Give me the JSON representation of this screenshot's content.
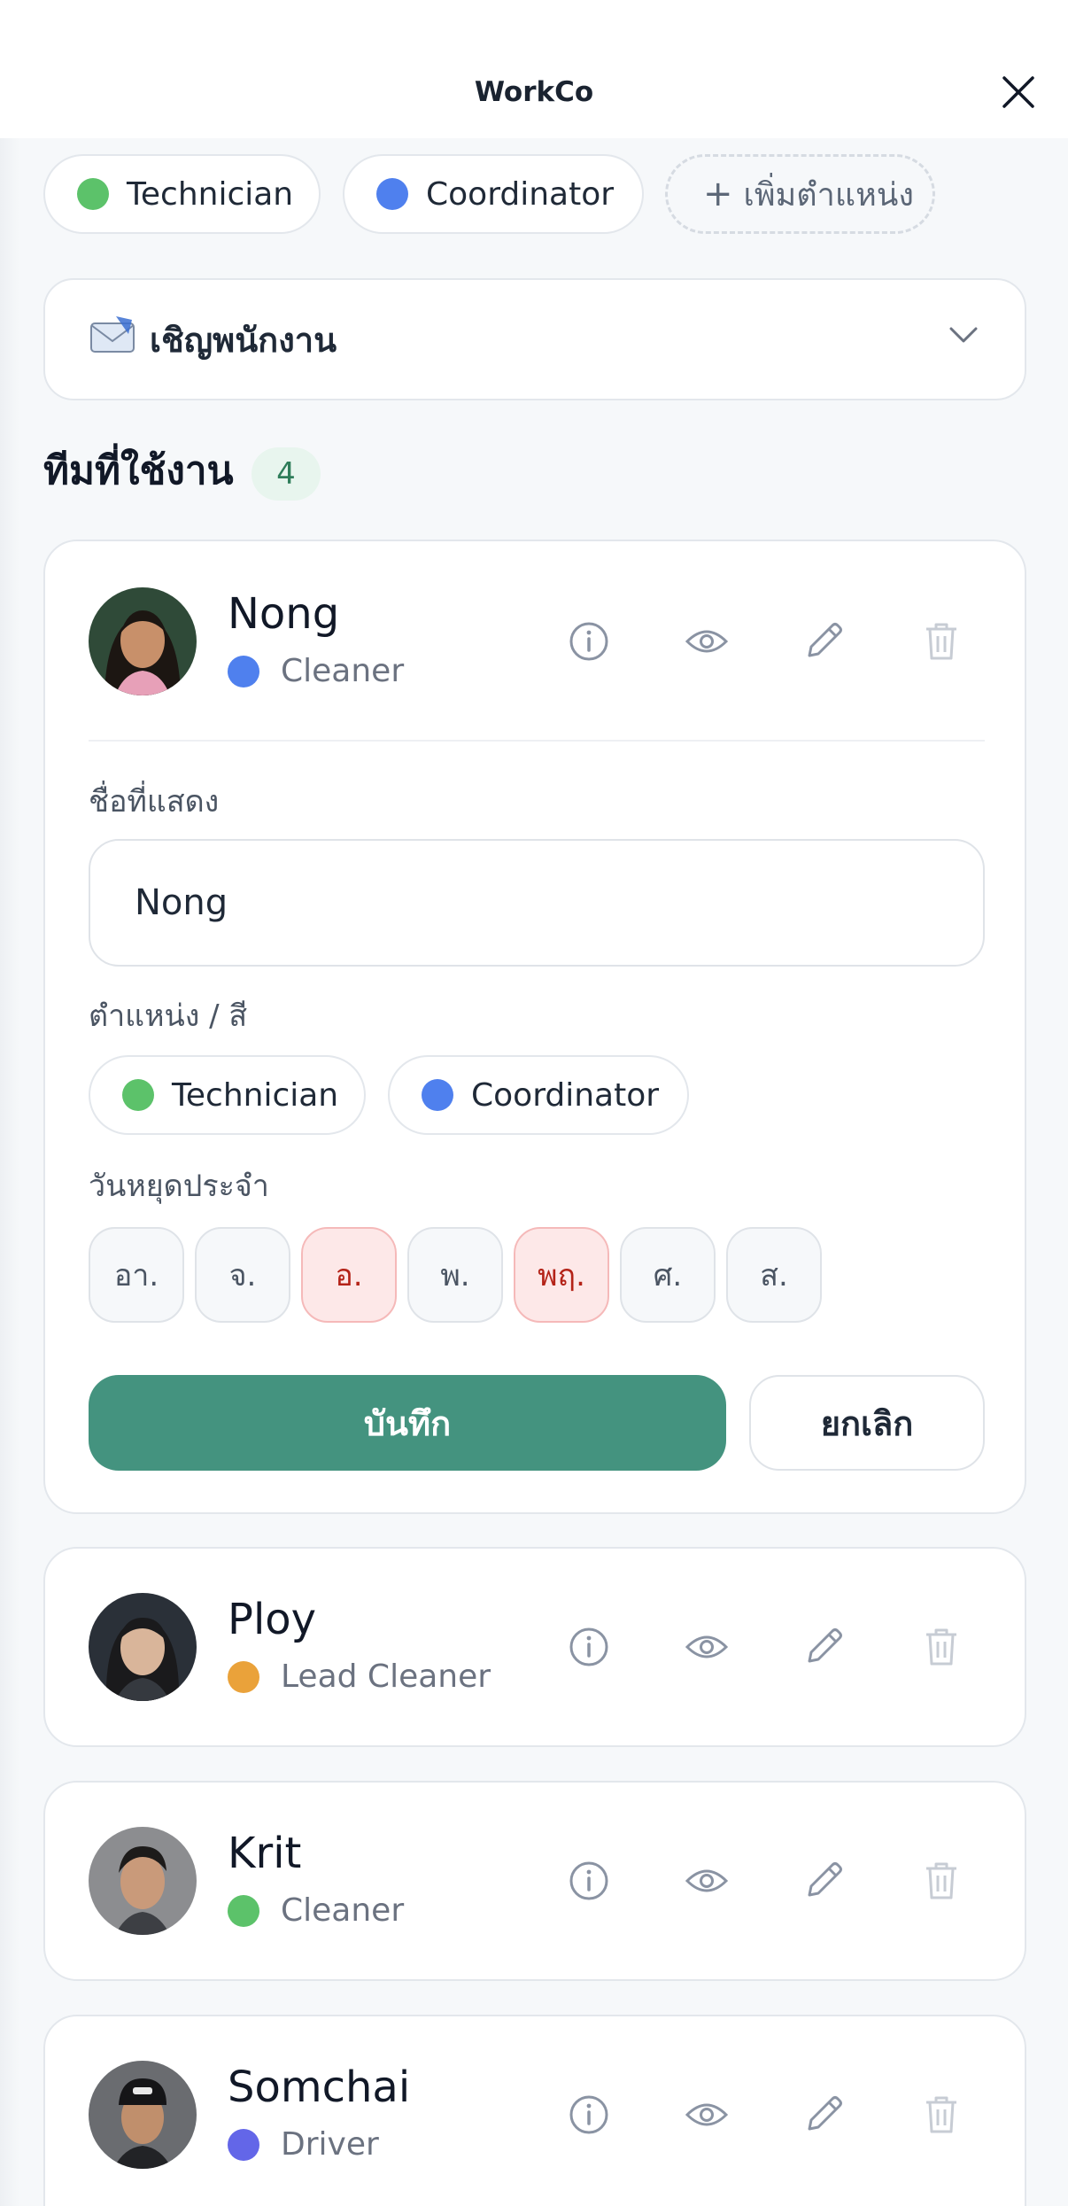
{
  "app": {
    "title": "WorkCo"
  },
  "roles": {
    "chips": [
      {
        "label": "Technician",
        "color": "#5cc26a"
      },
      {
        "label": "Coordinator",
        "color": "#4f80ee"
      }
    ],
    "add_label": "เพิ่มตำแหน่ง"
  },
  "invite": {
    "label": "เชิญพนักงาน",
    "icon": "envelope-icon"
  },
  "team": {
    "title": "ทีมที่ใช้งาน",
    "count": "4",
    "members": [
      {
        "name": "Nong",
        "role": "Cleaner",
        "role_color": "#4f80ee"
      },
      {
        "name": "Ploy",
        "role": "Lead Cleaner",
        "role_color": "#eaa23a"
      },
      {
        "name": "Krit",
        "role": "Cleaner",
        "role_color": "#5cc26a"
      },
      {
        "name": "Somchai",
        "role": "Driver",
        "role_color": "#6366e8"
      }
    ]
  },
  "editor": {
    "display_name_label": "ชื่อที่แสดง",
    "display_name_value": "Nong",
    "role_label": "ตำแหน่ง / สี",
    "role_options": [
      {
        "label": "Technician",
        "color": "#5cc26a"
      },
      {
        "label": "Coordinator",
        "color": "#4f80ee"
      }
    ],
    "days_off_label": "วันหยุดประจำ",
    "days": [
      {
        "label": "อา.",
        "off": false
      },
      {
        "label": "จ.",
        "off": false
      },
      {
        "label": "อ.",
        "off": true
      },
      {
        "label": "พ.",
        "off": false
      },
      {
        "label": "พฤ.",
        "off": true
      },
      {
        "label": "ศ.",
        "off": false
      },
      {
        "label": "ส.",
        "off": false
      }
    ],
    "save_label": "บันทึก",
    "cancel_label": "ยกเลิก"
  },
  "colors": {
    "accent": "#44937f",
    "day_off_bg": "#fde8e8",
    "day_off_text": "#b42318"
  }
}
